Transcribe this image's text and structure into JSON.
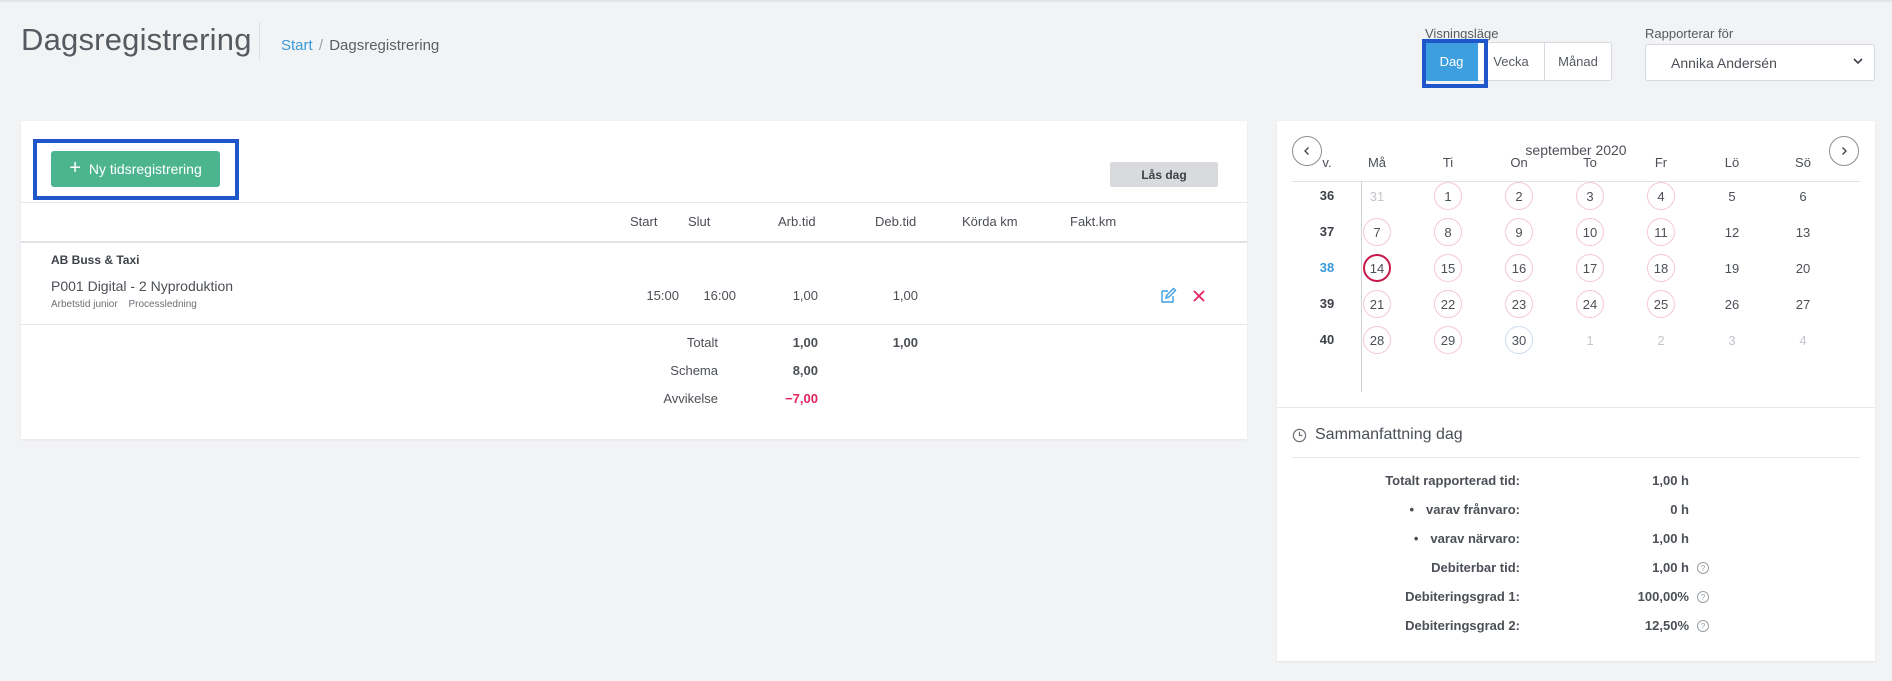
{
  "header": {
    "title": "Dagsregistrering",
    "breadcrumb": {
      "home": "Start",
      "separator": "/",
      "current": "Dagsregistrering"
    },
    "view_mode": {
      "label": "Visningsläge",
      "options": [
        "Dag",
        "Vecka",
        "Månad"
      ],
      "selected": "Dag"
    },
    "reporter": {
      "label": "Rapporterar för",
      "selected": "Annika Andersén"
    }
  },
  "actions": {
    "new_entry": "Ny tidsregistrering",
    "lock_day": "Lås dag"
  },
  "table": {
    "columns": {
      "start": "Start",
      "end": "Slut",
      "work_time": "Arb.tid",
      "billable": "Deb.tid",
      "driven_km": "Körda km",
      "invoiced_km": "Fakt.km"
    },
    "entry": {
      "customer": "AB Buss & Taxi",
      "project": "P001 Digital - 2 Nyproduktion",
      "tags": [
        "Arbetstid junior",
        "Processledning"
      ],
      "start": "15:00",
      "end": "16:00",
      "work_time": "1,00",
      "billable": "1,00"
    },
    "totals": {
      "total_label": "Totalt",
      "total_work": "1,00",
      "total_billable": "1,00",
      "schedule_label": "Schema",
      "schedule_value": "8,00",
      "deviation_label": "Avvikelse",
      "deviation_value": "−7,00"
    }
  },
  "calendar": {
    "month": "september 2020",
    "week_header": "v.",
    "day_headers": [
      "Må",
      "Ti",
      "On",
      "To",
      "Fr",
      "Lö",
      "Sö"
    ],
    "current_week": "38",
    "weeks": [
      {
        "week": "36",
        "days": [
          "31",
          "1",
          "2",
          "3",
          "4",
          "5",
          "6"
        ]
      },
      {
        "week": "37",
        "days": [
          "7",
          "8",
          "9",
          "10",
          "11",
          "12",
          "13"
        ]
      },
      {
        "week": "38",
        "days": [
          "14",
          "15",
          "16",
          "17",
          "18",
          "19",
          "20"
        ]
      },
      {
        "week": "39",
        "days": [
          "21",
          "22",
          "23",
          "24",
          "25",
          "26",
          "27"
        ]
      },
      {
        "week": "40",
        "days": [
          "28",
          "29",
          "30",
          "1",
          "2",
          "3",
          "4"
        ]
      }
    ]
  },
  "summary": {
    "title": "Sammanfattning dag",
    "rows": [
      {
        "label": "Totalt rapporterad tid:",
        "value": "1,00 h"
      },
      {
        "label": "varav frånvaro:",
        "value": "0 h"
      },
      {
        "label": "varav närvaro:",
        "value": "1,00 h"
      },
      {
        "label": "Debiterbar tid:",
        "value": "1,00 h"
      },
      {
        "label": "Debiteringsgrad 1:",
        "value": "100,00%"
      },
      {
        "label": "Debiteringsgrad 2:",
        "value": "12,50%"
      }
    ]
  },
  "colors": {
    "accent": "#3d9fe0",
    "primary_button": "#4cb58f",
    "negative": "#e0245e",
    "today_ring": "#c9184a"
  }
}
